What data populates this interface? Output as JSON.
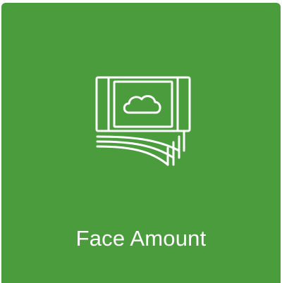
{
  "tile": {
    "label": "Face Amount",
    "icon": "banknote-cloud-icon",
    "colors": {
      "background": "#4a9c3d",
      "foreground": "#ffffff"
    }
  }
}
